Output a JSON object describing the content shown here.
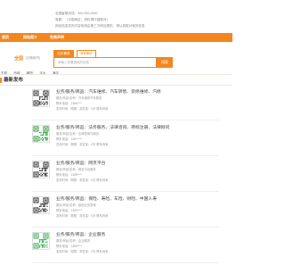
{
  "header": {
    "lines": [
      "全国客服热线：400-000-0000",
      "客服：（中国地区：资料请仔细核对）",
      "网站信息发布内容系统由第三方网站提供，请认真核对相关信息"
    ]
  },
  "nav": {
    "items": [
      "首页",
      "网站简介",
      "免责声明"
    ]
  },
  "location": {
    "city": "全国",
    "switch_label": "[切换城市]",
    "districts": [
      "东城",
      "西城",
      "朝阳",
      "丰台",
      "海淀"
    ]
  },
  "search": {
    "tabs": [
      "业务/服务",
      "商家黄页"
    ],
    "placeholder": "请输入您要搜索的信息",
    "button_label": "搜索"
  },
  "section": {
    "title": "最新发布"
  },
  "posts": [
    {
      "title": "业务/服务/商品：汽车维修、汽车转售、装修维修、汽修",
      "meta": [
        "服务/商品/名称：汽车维修汽车服务",
        "联系电话：1386****",
        "发布时间：刚刚 · 浏览量：0次 联系商家"
      ]
    },
    {
      "title": "业务/服务/商品：法务服务、法律咨询、商标注册、法律顾问",
      "meta": [
        "服务/商品/名称：法律咨询与服务",
        "联系电话：1387****",
        "发布时间：刚刚 · 浏览量：0次 联系商家"
      ]
    },
    {
      "title": "业务/服务/商品：网页平台",
      "meta": [
        "服务/商品/名称：网页平台服务",
        "联系电话：1385****",
        "发布时间：刚刚 · 浏览量：0次 联系商家"
      ]
    },
    {
      "title": "业务/服务/商品：保险、寿险、车险、财险、中国人寿",
      "meta": [
        "服务/商品/名称：保险业务咨询",
        "联系电话：1389****",
        "发布时间：刚刚 · 浏览量：0次 联系商家"
      ]
    },
    {
      "title": "业务/服务/商品：企业服务",
      "meta": [
        "服务/商品/名称：企业服务",
        "联系电话：1388****",
        "发布时间：刚刚 · 浏览量：0次 联系商家"
      ]
    }
  ],
  "colors": {
    "accent": "#f2871f",
    "qr_colors": [
      "#2b2b2b",
      "#2a9a3a",
      "#2b2b2b",
      "#2b2b2b",
      "#34a853"
    ]
  },
  "icons": [
    "qr-code-icon"
  ]
}
